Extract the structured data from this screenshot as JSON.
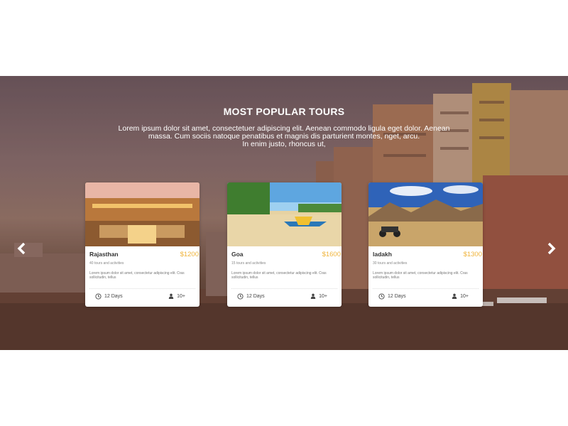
{
  "section": {
    "title": "MOST POPULAR TOURS",
    "subtitle_lines": [
      "Lorem ipsum dolor sit amet, consectetuer adipiscing elit. Aenean commodo ligula eget dolor. Aenean",
      "massa. Cum sociis natoque penatibus et magnis dis parturient montes, nget, arcu.",
      "In enim justo, rhoncus ut,"
    ]
  },
  "carousel": {
    "prev_icon": "chevron-left-icon",
    "next_icon": "chevron-right-icon",
    "cards": [
      {
        "name": "Rajasthan",
        "price": "$1200",
        "tours": "40 tours and activities",
        "desc": "Lorem ipsum dolor sit amet, consectetur adipiscing elit. Cras sollicitudin, tellus",
        "days": "12 Days",
        "people": "10+"
      },
      {
        "name": "Goa",
        "price": "$1600",
        "tours": "15 tours and activities",
        "desc": "Lorem ipsum dolor sit amet, consectetur adipiscing elit. Cras sollicitudin, tellus",
        "days": "12 Days",
        "people": "10+"
      },
      {
        "name": "ladakh",
        "price": "$1300",
        "tours": "30 tours and activities",
        "desc": "Lorem ipsum dolor sit amet, consectetur adipiscing elit. Cras sollicitudin, tellus",
        "days": "12 Days",
        "people": "10+"
      }
    ]
  },
  "colors": {
    "price": "#f0b43a",
    "card_bg": "#ffffff",
    "hero_overlay": "#8a6f6e"
  }
}
